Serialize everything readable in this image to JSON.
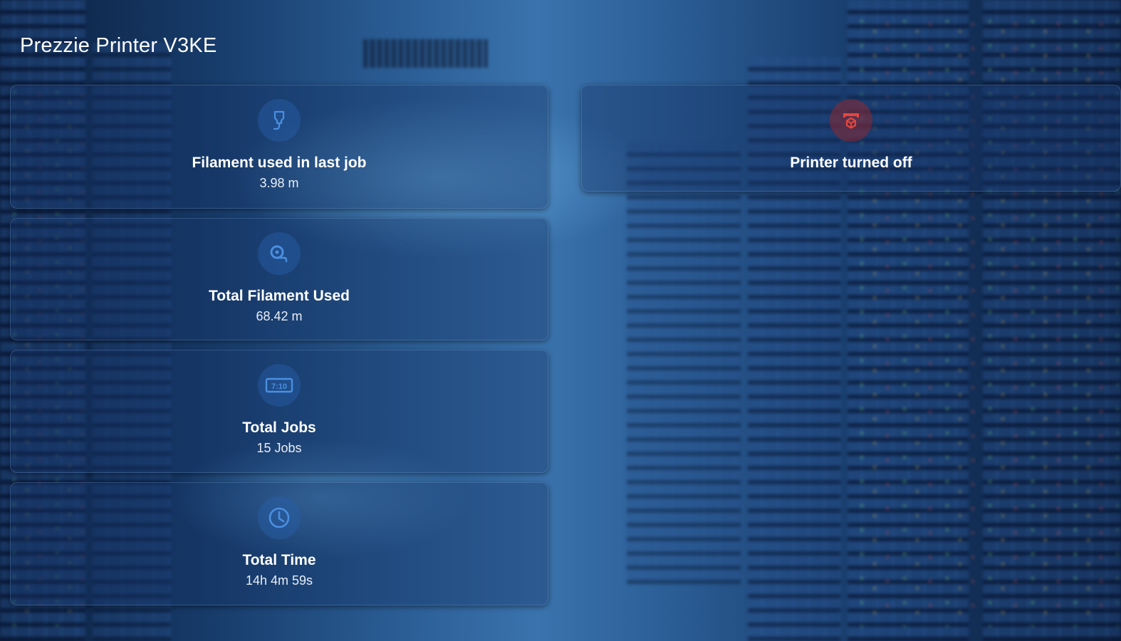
{
  "header": {
    "title": "Prezzie Printer V3KE"
  },
  "cards": [
    {
      "id": "filament-last-job",
      "label": "Filament used in last job",
      "value": "3.98 m",
      "icon": "filament-drop-icon"
    },
    {
      "id": "total-filament",
      "label": "Total Filament Used",
      "value": "68.42 m",
      "icon": "filament-spool-icon"
    },
    {
      "id": "total-jobs",
      "label": "Total Jobs",
      "value": "15 Jobs",
      "icon": "counter-display-icon"
    },
    {
      "id": "total-time",
      "label": "Total Time",
      "value": "14h 4m 59s",
      "icon": "clock-icon"
    }
  ],
  "status_card": {
    "label": "Printer turned off",
    "icon": "printer-3d-off-icon",
    "color": "#e8453c"
  },
  "colors": {
    "accent": "#4a8fe0",
    "icon_fg": "#4a8fe0",
    "off": "#e8453c"
  },
  "icon_text": {
    "counter": "7:10"
  }
}
